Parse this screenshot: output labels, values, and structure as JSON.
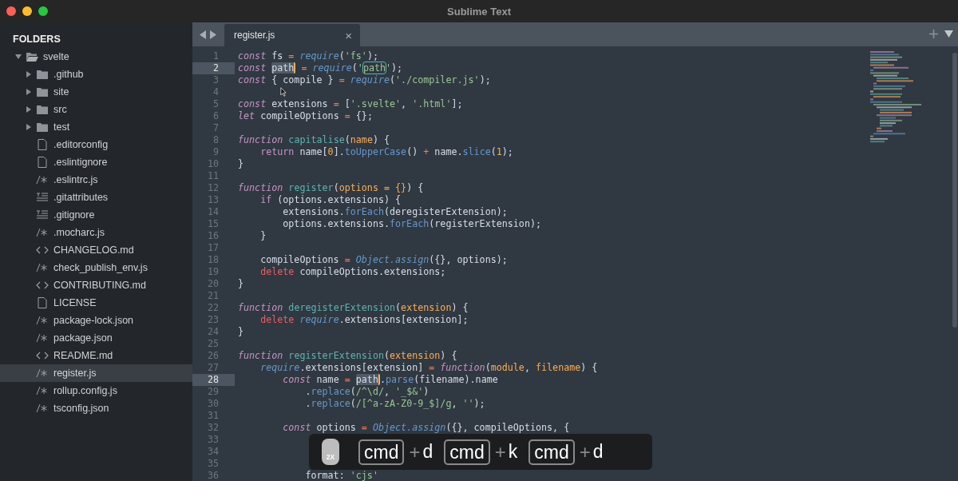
{
  "window": {
    "title": "Sublime Text"
  },
  "sidebar": {
    "title": "FOLDERS",
    "tree": [
      {
        "label": "svelte",
        "kind": "folder",
        "expanded": true,
        "selected": false,
        "children": [
          {
            "label": ".github",
            "kind": "folder",
            "expanded": false,
            "selected": false
          },
          {
            "label": "site",
            "kind": "folder",
            "expanded": false,
            "selected": false
          },
          {
            "label": "src",
            "kind": "folder",
            "expanded": false,
            "selected": false
          },
          {
            "label": "test",
            "kind": "folder",
            "expanded": false,
            "selected": false
          },
          {
            "label": ".editorconfig",
            "kind": "file",
            "selected": false
          },
          {
            "label": ".eslintignore",
            "kind": "file",
            "selected": false
          },
          {
            "label": ".eslintrc.js",
            "kind": "script",
            "selected": false
          },
          {
            "label": ".gitattributes",
            "kind": "text",
            "selected": false
          },
          {
            "label": ".gitignore",
            "kind": "text",
            "selected": false
          },
          {
            "label": ".mocharc.js",
            "kind": "script",
            "selected": false
          },
          {
            "label": "CHANGELOG.md",
            "kind": "markup",
            "selected": false
          },
          {
            "label": "check_publish_env.js",
            "kind": "script",
            "selected": false
          },
          {
            "label": "CONTRIBUTING.md",
            "kind": "markup",
            "selected": false
          },
          {
            "label": "LICENSE",
            "kind": "file",
            "selected": false
          },
          {
            "label": "package-lock.json",
            "kind": "script",
            "selected": false
          },
          {
            "label": "package.json",
            "kind": "script",
            "selected": false
          },
          {
            "label": "README.md",
            "kind": "markup",
            "selected": false
          },
          {
            "label": "register.js",
            "kind": "script",
            "selected": true
          },
          {
            "label": "rollup.config.js",
            "kind": "script",
            "selected": false
          },
          {
            "label": "tsconfig.json",
            "kind": "script",
            "selected": false
          }
        ]
      }
    ]
  },
  "tabs": [
    {
      "label": "register.js",
      "selected": true,
      "close": "×"
    }
  ],
  "editor": {
    "lines": [
      {
        "number": "1",
        "active": false,
        "tokens": [
          {
            "kind": "kw",
            "text": "const"
          },
          {
            "kind": "plain",
            "text": " fs "
          },
          {
            "kind": "op",
            "text": "= "
          },
          {
            "kind": "call",
            "text": "require"
          },
          {
            "kind": "plain",
            "text": "("
          },
          {
            "kind": "str",
            "text": "'fs'"
          },
          {
            "kind": "plain",
            "text": ");"
          }
        ]
      },
      {
        "number": "2",
        "active": true,
        "tokens": [
          {
            "kind": "kw",
            "text": "const "
          },
          {
            "kind": "selection",
            "text": "path"
          },
          {
            "kind": "op",
            "text": " = "
          },
          {
            "kind": "call",
            "text": "require"
          },
          {
            "kind": "plain",
            "text": "("
          },
          {
            "kind": "str",
            "text": "'"
          },
          {
            "kind": "match",
            "text": "path"
          },
          {
            "kind": "str",
            "text": "'"
          },
          {
            "kind": "plain",
            "text": ");"
          }
        ]
      },
      {
        "number": "3",
        "active": false,
        "tokens": [
          {
            "kind": "kw",
            "text": "const"
          },
          {
            "kind": "plain",
            "text": " { compile } "
          },
          {
            "kind": "op",
            "text": "= "
          },
          {
            "kind": "call",
            "text": "require"
          },
          {
            "kind": "plain",
            "text": "("
          },
          {
            "kind": "str",
            "text": "'./compiler.js'"
          },
          {
            "kind": "plain",
            "text": ");"
          }
        ]
      },
      {
        "number": "4",
        "active": false
      },
      {
        "number": "5",
        "active": false,
        "tokens": [
          {
            "kind": "kw",
            "text": "const"
          },
          {
            "kind": "plain",
            "text": " extensions "
          },
          {
            "kind": "op",
            "text": "="
          },
          {
            "kind": "plain",
            "text": " ["
          },
          {
            "kind": "str",
            "text": "'.svelte'"
          },
          {
            "kind": "plain",
            "text": ", "
          },
          {
            "kind": "str",
            "text": "'.html'"
          },
          {
            "kind": "plain",
            "text": "];"
          }
        ]
      },
      {
        "number": "6",
        "active": false,
        "tokens": [
          {
            "kind": "kw",
            "text": "let"
          },
          {
            "kind": "plain",
            "text": " compileOptions "
          },
          {
            "kind": "op",
            "text": "="
          },
          {
            "kind": "plain",
            "text": " {};"
          }
        ]
      },
      {
        "number": "7",
        "active": false
      },
      {
        "number": "8",
        "active": false,
        "tokens": [
          {
            "kind": "kw",
            "text": "function "
          },
          {
            "kind": "fn",
            "text": "capitalise"
          },
          {
            "kind": "plain",
            "text": "("
          },
          {
            "kind": "param",
            "text": "name"
          },
          {
            "kind": "plain",
            "text": ") {"
          }
        ]
      },
      {
        "number": "9",
        "active": false,
        "tokens": [
          {
            "kind": "control",
            "text": "    return"
          },
          {
            "kind": "plain",
            "text": " name["
          },
          {
            "kind": "num",
            "text": "0"
          },
          {
            "kind": "plain",
            "text": "]."
          },
          {
            "kind": "method",
            "text": "toUpperCase"
          },
          {
            "kind": "plain",
            "text": "() "
          },
          {
            "kind": "op",
            "text": "+"
          },
          {
            "kind": "plain",
            "text": " name."
          },
          {
            "kind": "method",
            "text": "slice"
          },
          {
            "kind": "plain",
            "text": "("
          },
          {
            "kind": "num",
            "text": "1"
          },
          {
            "kind": "plain",
            "text": ");"
          }
        ]
      },
      {
        "number": "10",
        "active": false,
        "tokens": [
          {
            "kind": "plain",
            "text": "}"
          }
        ]
      },
      {
        "number": "11",
        "active": false
      },
      {
        "number": "12",
        "active": false,
        "tokens": [
          {
            "kind": "kw",
            "text": "function "
          },
          {
            "kind": "fn",
            "text": "register"
          },
          {
            "kind": "plain",
            "text": "("
          },
          {
            "kind": "param",
            "text": "options = {}"
          },
          {
            "kind": "plain",
            "text": ") {"
          }
        ]
      },
      {
        "number": "13",
        "active": false,
        "tokens": [
          {
            "kind": "control",
            "text": "    if"
          },
          {
            "kind": "plain",
            "text": " (options.extensions) {"
          }
        ]
      },
      {
        "number": "14",
        "active": false,
        "tokens": [
          {
            "kind": "plain",
            "text": "        extensions."
          },
          {
            "kind": "method",
            "text": "forEach"
          },
          {
            "kind": "plain",
            "text": "(deregisterExtension);"
          }
        ]
      },
      {
        "number": "15",
        "active": false,
        "tokens": [
          {
            "kind": "plain",
            "text": "        options.extensions."
          },
          {
            "kind": "method",
            "text": "forEach"
          },
          {
            "kind": "plain",
            "text": "(registerExtension);"
          }
        ]
      },
      {
        "number": "16",
        "active": false,
        "tokens": [
          {
            "kind": "plain",
            "text": "    }"
          }
        ]
      },
      {
        "number": "17",
        "active": false
      },
      {
        "number": "18",
        "active": false,
        "tokens": [
          {
            "kind": "plain",
            "text": "    compileOptions "
          },
          {
            "kind": "op",
            "text": "= "
          },
          {
            "kind": "call",
            "text": "Object.assign"
          },
          {
            "kind": "plain",
            "text": "({}, options);"
          }
        ]
      },
      {
        "number": "19",
        "active": false,
        "tokens": [
          {
            "kind": "delete",
            "text": "    delete"
          },
          {
            "kind": "plain",
            "text": " compileOptions.extensions;"
          }
        ]
      },
      {
        "number": "20",
        "active": false,
        "tokens": [
          {
            "kind": "plain",
            "text": "}"
          }
        ]
      },
      {
        "number": "21",
        "active": false
      },
      {
        "number": "22",
        "active": false,
        "tokens": [
          {
            "kind": "kw",
            "text": "function "
          },
          {
            "kind": "fn",
            "text": "deregisterExtension"
          },
          {
            "kind": "plain",
            "text": "("
          },
          {
            "kind": "param",
            "text": "extension"
          },
          {
            "kind": "plain",
            "text": ") {"
          }
        ]
      },
      {
        "number": "23",
        "active": false,
        "tokens": [
          {
            "kind": "delete",
            "text": "    delete "
          },
          {
            "kind": "call",
            "text": "require"
          },
          {
            "kind": "plain",
            "text": ".extensions[extension];"
          }
        ]
      },
      {
        "number": "24",
        "active": false,
        "tokens": [
          {
            "kind": "plain",
            "text": "}"
          }
        ]
      },
      {
        "number": "25",
        "active": false
      },
      {
        "number": "26",
        "active": false,
        "tokens": [
          {
            "kind": "kw",
            "text": "function "
          },
          {
            "kind": "fn",
            "text": "registerExtension"
          },
          {
            "kind": "plain",
            "text": "("
          },
          {
            "kind": "param",
            "text": "extension"
          },
          {
            "kind": "plain",
            "text": ") {"
          }
        ]
      },
      {
        "number": "27",
        "active": false,
        "tokens": [
          {
            "kind": "call",
            "text": "    require"
          },
          {
            "kind": "plain",
            "text": ".extensions[extension] "
          },
          {
            "kind": "op",
            "text": "= "
          },
          {
            "kind": "kw",
            "text": "function"
          },
          {
            "kind": "plain",
            "text": "("
          },
          {
            "kind": "param",
            "text": "module"
          },
          {
            "kind": "plain",
            "text": ", "
          },
          {
            "kind": "param",
            "text": "filename"
          },
          {
            "kind": "plain",
            "text": ") {"
          }
        ]
      },
      {
        "number": "28",
        "active": true,
        "tokens": [
          {
            "kind": "kw",
            "text": "        const"
          },
          {
            "kind": "plain",
            "text": " name "
          },
          {
            "kind": "op",
            "text": "= "
          },
          {
            "kind": "selection",
            "text": "path"
          },
          {
            "kind": "plain",
            "text": "."
          },
          {
            "kind": "method",
            "text": "parse"
          },
          {
            "kind": "plain",
            "text": "(filename).name"
          }
        ]
      },
      {
        "number": "29",
        "active": false,
        "tokens": [
          {
            "kind": "plain",
            "text": "            ."
          },
          {
            "kind": "method",
            "text": "replace"
          },
          {
            "kind": "plain",
            "text": "("
          },
          {
            "kind": "str",
            "text": "/^\\d/"
          },
          {
            "kind": "plain",
            "text": ", "
          },
          {
            "kind": "str",
            "text": "'_$&'"
          },
          {
            "kind": "plain",
            "text": ")"
          }
        ]
      },
      {
        "number": "30",
        "active": false,
        "tokens": [
          {
            "kind": "plain",
            "text": "            ."
          },
          {
            "kind": "method",
            "text": "replace"
          },
          {
            "kind": "plain",
            "text": "("
          },
          {
            "kind": "str",
            "text": "/[^a-zA-Z0-9_$]/g"
          },
          {
            "kind": "plain",
            "text": ", "
          },
          {
            "kind": "str",
            "text": "''"
          },
          {
            "kind": "plain",
            "text": ");"
          }
        ]
      },
      {
        "number": "31",
        "active": false
      },
      {
        "number": "32",
        "active": false,
        "tokens": [
          {
            "kind": "kw",
            "text": "        const"
          },
          {
            "kind": "plain",
            "text": " options "
          },
          {
            "kind": "op",
            "text": "= "
          },
          {
            "kind": "call",
            "text": "Object.assign"
          },
          {
            "kind": "plain",
            "text": "({}, compileOptions, {"
          }
        ]
      },
      {
        "number": "33",
        "active": false
      },
      {
        "number": "34",
        "active": false
      },
      {
        "number": "35",
        "active": false
      },
      {
        "number": "36",
        "active": false,
        "tokens": [
          {
            "kind": "plain",
            "text": "            format: "
          },
          {
            "kind": "str",
            "text": "'cjs'"
          }
        ]
      }
    ]
  },
  "keystrokes": {
    "badge": "2X",
    "keys": [
      {
        "modifier": "cmd",
        "plus": "+",
        "key": "d"
      },
      {
        "modifier": "cmd",
        "plus": "+",
        "key": "k"
      },
      {
        "modifier": "cmd",
        "plus": "+",
        "key": "d"
      }
    ]
  }
}
